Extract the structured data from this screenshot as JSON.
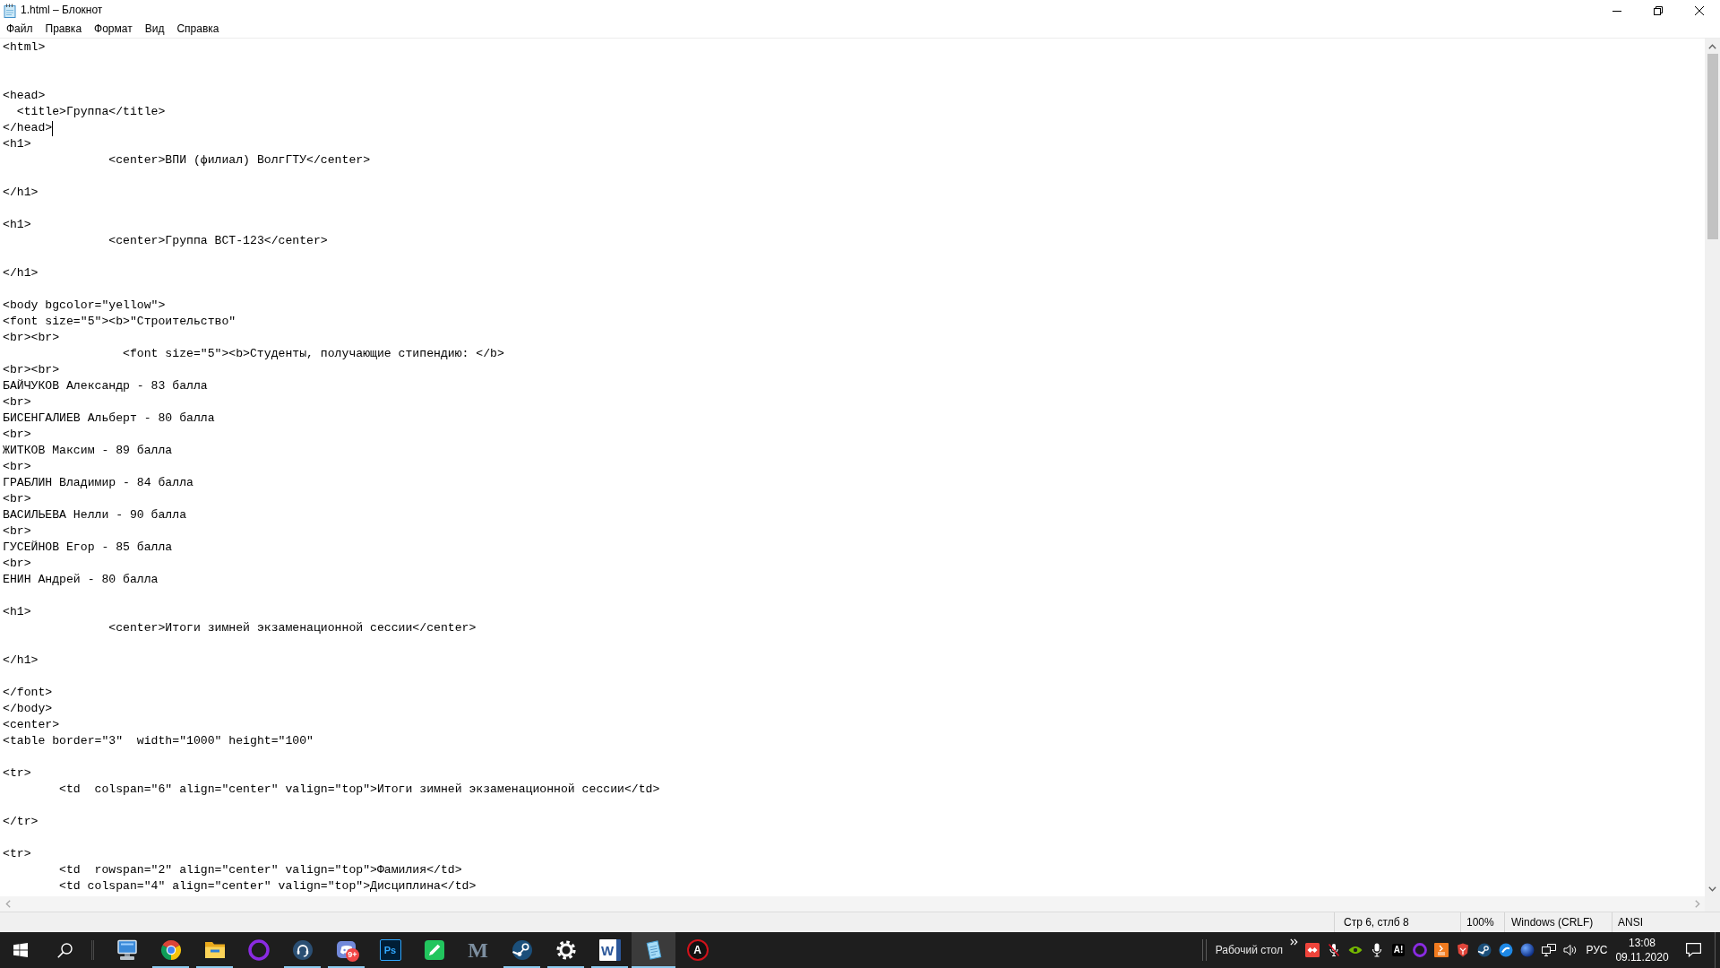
{
  "window": {
    "title": "1.html – Блокнот"
  },
  "menu": [
    "Файл",
    "Правка",
    "Формат",
    "Вид",
    "Справка"
  ],
  "editor": {
    "lines": [
      {
        "text": "<html>",
        "caret": false
      },
      {
        "caret": false
      },
      {
        "caret": false
      },
      {
        "text": "<head>",
        "caret": false
      },
      {
        "text": "  <title>Группа</title>",
        "caret": false
      },
      {
        "text": "</head>",
        "caret": true
      },
      {
        "text": "<h1>",
        "caret": false
      },
      {
        "text": "               <center>ВПИ (филиал) ВолгГТУ</center>",
        "caret": false
      },
      {
        "caret": false
      },
      {
        "text": "</h1>",
        "caret": false
      },
      {
        "caret": false
      },
      {
        "text": "<h1>",
        "caret": false
      },
      {
        "text": "               <center>Группа ВСТ-123</center>",
        "caret": false
      },
      {
        "caret": false
      },
      {
        "text": "</h1>",
        "caret": false
      },
      {
        "caret": false
      },
      {
        "text": "<body bgcolor=\"yellow\">",
        "caret": false
      },
      {
        "text": "<font size=\"5\"><b>\"Строительство\"",
        "caret": false
      },
      {
        "text": "<br><br>",
        "caret": false
      },
      {
        "text": "                 <font size=\"5\"><b>Студенты, получающие стипендию: </b>",
        "caret": false
      },
      {
        "text": "<br><br>",
        "caret": false
      },
      {
        "text": "БАЙЧУКОВ Александр - 83 балла",
        "caret": false
      },
      {
        "text": "<br>",
        "caret": false
      },
      {
        "text": "БИСЕНГАЛИЕВ Альберт - 80 балла",
        "caret": false
      },
      {
        "text": "<br>",
        "caret": false
      },
      {
        "text": "ЖИТКОВ Максим - 89 балла",
        "caret": false
      },
      {
        "text": "<br>",
        "caret": false
      },
      {
        "text": "ГРАБЛИН Владимир - 84 балла",
        "caret": false
      },
      {
        "text": "<br>",
        "caret": false
      },
      {
        "text": "ВАСИЛЬЕВА Нелли - 90 балла",
        "caret": false
      },
      {
        "text": "<br>",
        "caret": false
      },
      {
        "text": "ГУСЕЙНОВ Егор - 85 балла",
        "caret": false
      },
      {
        "text": "<br>",
        "caret": false
      },
      {
        "text": "ЕНИН Андрей - 80 балла",
        "caret": false
      },
      {
        "caret": false
      },
      {
        "text": "<h1>",
        "caret": false
      },
      {
        "text": "               <center>Итоги зимней экзаменационной сессии</center>",
        "caret": false
      },
      {
        "caret": false
      },
      {
        "text": "</h1>",
        "caret": false
      },
      {
        "caret": false
      },
      {
        "text": "</font>",
        "caret": false
      },
      {
        "text": "</body>",
        "caret": false
      },
      {
        "text": "<center>",
        "caret": false
      },
      {
        "text": "<table border=\"3\"  width=\"1000\" height=\"100\"",
        "caret": false
      },
      {
        "caret": false
      },
      {
        "text": "<tr>",
        "caret": false
      },
      {
        "text": "        <td  colspan=\"6\" align=\"center\" valign=\"top\">Итоги зимней экзаменационной сессии</td>",
        "caret": false
      },
      {
        "caret": false
      },
      {
        "text": "</tr>",
        "caret": false
      },
      {
        "caret": false
      },
      {
        "text": "<tr>",
        "caret": false
      },
      {
        "text": "        <td  rowspan=\"2\" align=\"center\" valign=\"top\">Фамилия</td>",
        "caret": false
      },
      {
        "text": "        <td colspan=\"4\" align=\"center\" valign=\"top\">Дисциплина</td>",
        "caret": false
      }
    ]
  },
  "status_bar": {
    "position": "Стр 6, стлб 8",
    "zoom": "100%",
    "line_endings": "Windows (CRLF)",
    "encoding": "ANSI"
  },
  "taskbar": {
    "apps": [
      {
        "running": false,
        "selected": false
      },
      {
        "running": true,
        "selected": false
      },
      {
        "running": true,
        "selected": false
      },
      {
        "running": false,
        "selected": false
      },
      {
        "running": true,
        "selected": false
      },
      {
        "running": true,
        "selected": false,
        "badge": "9+"
      },
      {
        "running": false,
        "selected": false,
        "glyph": "Ps"
      },
      {
        "running": false,
        "selected": false
      },
      {
        "running": false,
        "selected": false,
        "glyph": "M"
      },
      {
        "running": true,
        "selected": false
      },
      {
        "running": true,
        "selected": false
      },
      {
        "running": true,
        "selected": false,
        "glyph": "W"
      },
      {
        "running": true,
        "selected": true
      },
      {
        "running": false,
        "selected": false,
        "glyph": "A"
      }
    ],
    "desktop_toolbar": "Рабочий стол",
    "tray_icon_text": "A!",
    "language": "РУС",
    "time": "13:08",
    "date": "09.11.2020"
  }
}
